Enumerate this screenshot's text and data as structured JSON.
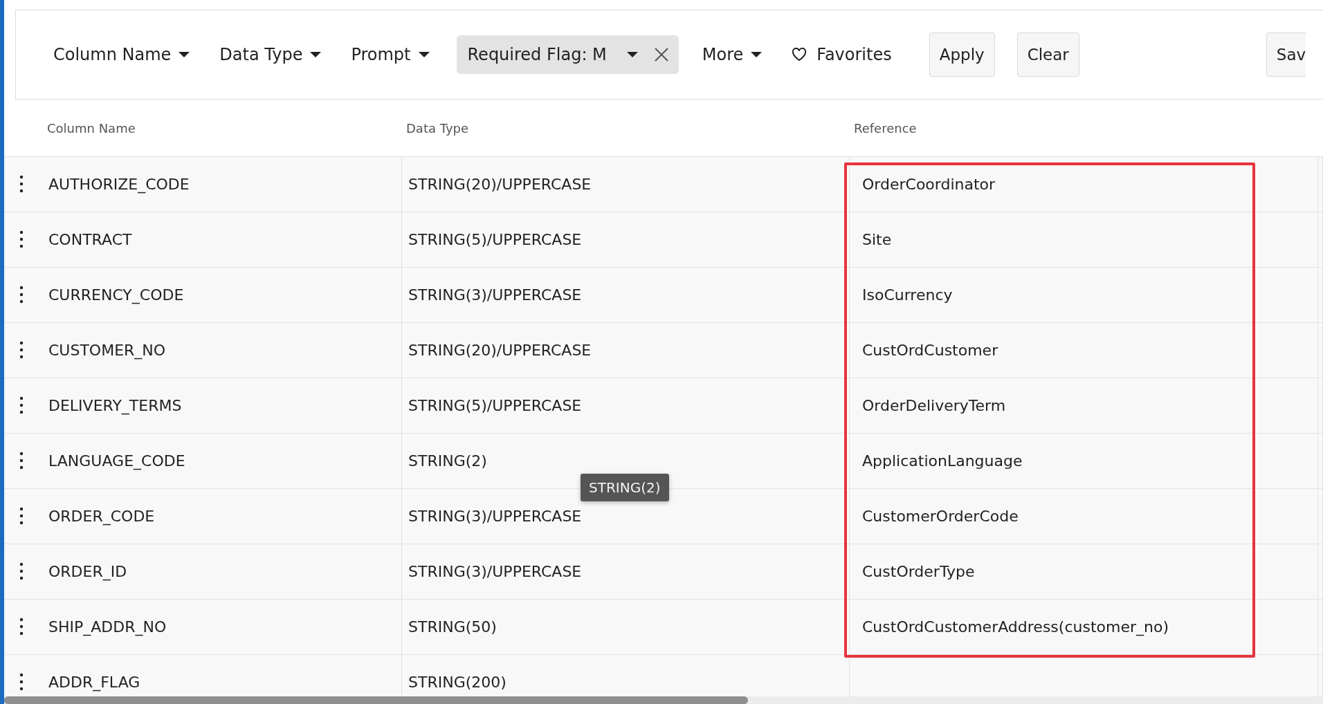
{
  "filters": [
    {
      "kind": "dropdown",
      "label": "Column Name"
    },
    {
      "kind": "dropdown",
      "label": "Data Type"
    },
    {
      "kind": "dropdown",
      "label": "Prompt"
    },
    {
      "kind": "chip",
      "label": "Required Flag: M"
    },
    {
      "kind": "dropdown",
      "label": "More"
    },
    {
      "kind": "favorites",
      "label": "Favorites"
    }
  ],
  "buttons": [
    "Apply",
    "Clear",
    "Sav"
  ],
  "table": {
    "columns": [
      "Column Name",
      "Data Type",
      "Reference"
    ],
    "reference_highlighted": true,
    "rows": [
      {
        "name": "AUTHORIZE_CODE",
        "type": "STRING(20)/UPPERCASE",
        "reference": "OrderCoordinator"
      },
      {
        "name": "CONTRACT",
        "type": "STRING(5)/UPPERCASE",
        "reference": "Site"
      },
      {
        "name": "CURRENCY_CODE",
        "type": "STRING(3)/UPPERCASE",
        "reference": "IsoCurrency"
      },
      {
        "name": "CUSTOMER_NO",
        "type": "STRING(20)/UPPERCASE",
        "reference": "CustOrdCustomer"
      },
      {
        "name": "DELIVERY_TERMS",
        "type": "STRING(5)/UPPERCASE",
        "reference": "OrderDeliveryTerm"
      },
      {
        "name": "LANGUAGE_CODE",
        "type": "STRING(2)",
        "reference": "ApplicationLanguage",
        "tooltip": "STRING(2)"
      },
      {
        "name": "ORDER_CODE",
        "type": "STRING(3)/UPPERCASE",
        "reference": "CustomerOrderCode"
      },
      {
        "name": "ORDER_ID",
        "type": "STRING(3)/UPPERCASE",
        "reference": "CustOrderType"
      },
      {
        "name": "SHIP_ADDR_NO",
        "type": "STRING(50)",
        "reference": "CustOrdCustomerAddress(customer_no)"
      },
      {
        "name": "ADDR_FLAG",
        "type": "STRING(200)"
      }
    ]
  }
}
